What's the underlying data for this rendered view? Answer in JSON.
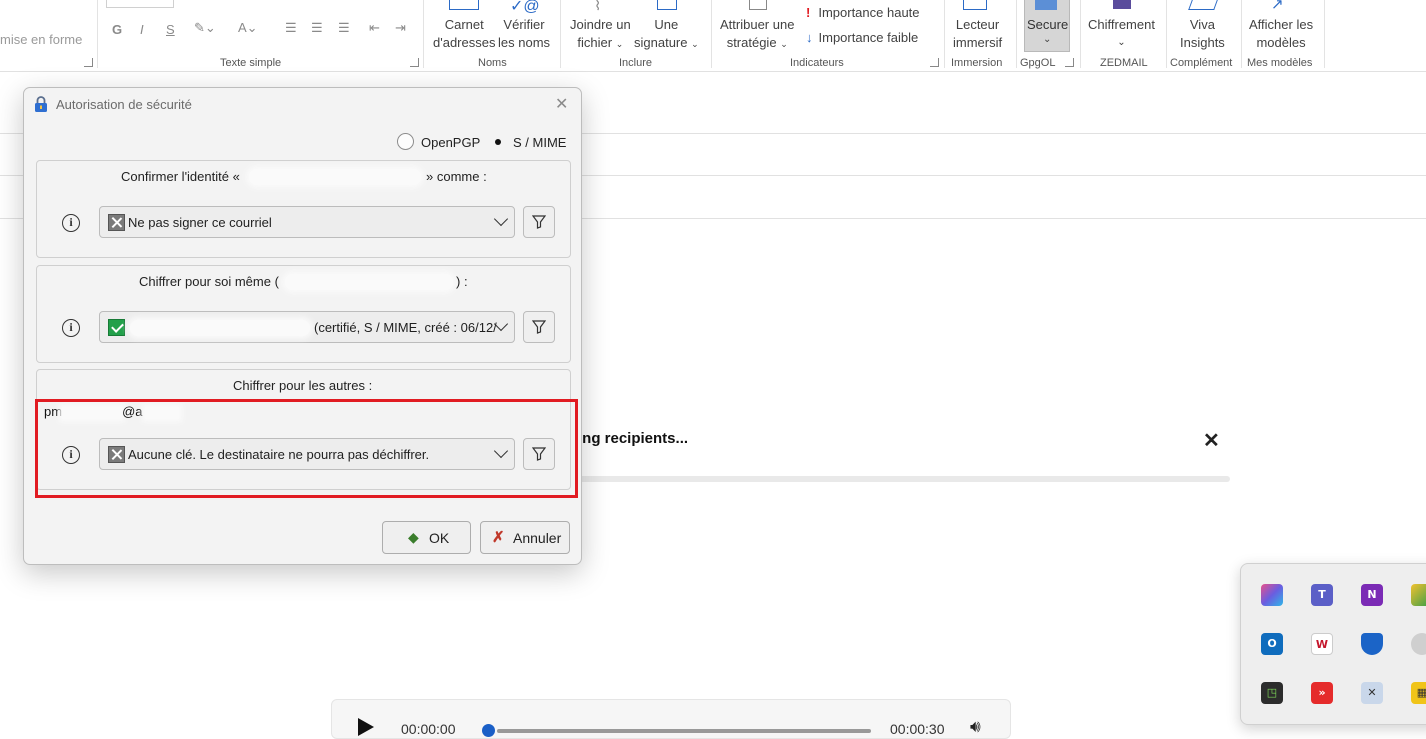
{
  "ribbon": {
    "clipped_format_label": "mise en forme",
    "groups": {
      "texte_simple": "Texte simple",
      "noms": "Noms",
      "inclure": "Inclure",
      "indicateurs": "Indicateurs",
      "immersion": "Immersion",
      "gpgol": "GpgOL",
      "zedmail": "ZEDMAIL",
      "complement": "Complément",
      "mes_modeles": "Mes modèles"
    },
    "buttons": {
      "carnet_line1": "Carnet",
      "carnet_line2": "d'adresses",
      "verifier_line1": "Vérifier",
      "verifier_line2": "les noms",
      "joindre_line1": "Joindre un",
      "joindre_line2": "fichier",
      "signature_line1": "Une",
      "signature_line2": "signature",
      "strategie_line1": "Attribuer une",
      "strategie_line2": "stratégie",
      "importance_haute": "Importance haute",
      "importance_faible": "Importance faible",
      "lecteur_line1": "Lecteur",
      "lecteur_line2": "immersif",
      "secure": "Secure",
      "chiffrement": "Chiffrement",
      "viva_line1": "Viva",
      "viva_line2": "Insights",
      "modeles_line1": "Afficher les",
      "modeles_line2": "modèles"
    },
    "format_glyphs": {
      "g": "G",
      "i": "I",
      "s": "S",
      "a": "A"
    }
  },
  "background": {
    "recipients_text": "ing recipients...",
    "close_glyph": "✕"
  },
  "player": {
    "current_time": "00:00:00",
    "total_time": "00:00:30",
    "progress": 0
  },
  "dialog": {
    "title": "Autorisation de sécurité",
    "close_glyph": "✕",
    "radio_openpgp": "OpenPGP",
    "radio_smime": "S / MIME",
    "selected_protocol": "S / MIME",
    "section_identity": {
      "title_prefix": "Confirmer l'identité «",
      "title_suffix": "» comme :",
      "combo_value": "Ne pas signer ce courriel"
    },
    "section_self": {
      "title_prefix": "Chiffrer pour soi même (",
      "title_suffix": ") :",
      "combo_value": "(certifié, S / MIME, créé : 06/12/"
    },
    "section_others": {
      "title": "Chiffrer pour les autres :",
      "recipient_prefix": "pm",
      "recipient_suffix": "@a",
      "combo_value": "Aucune clé. Le destinataire ne pourra pas déchiffrer."
    },
    "info_glyph": "i",
    "ok_label": "OK",
    "cancel_label": "Annuler"
  },
  "colors": {
    "highlight": "#e11b22",
    "ok_status": "#22a04a",
    "accent": "#2b6ac6"
  }
}
